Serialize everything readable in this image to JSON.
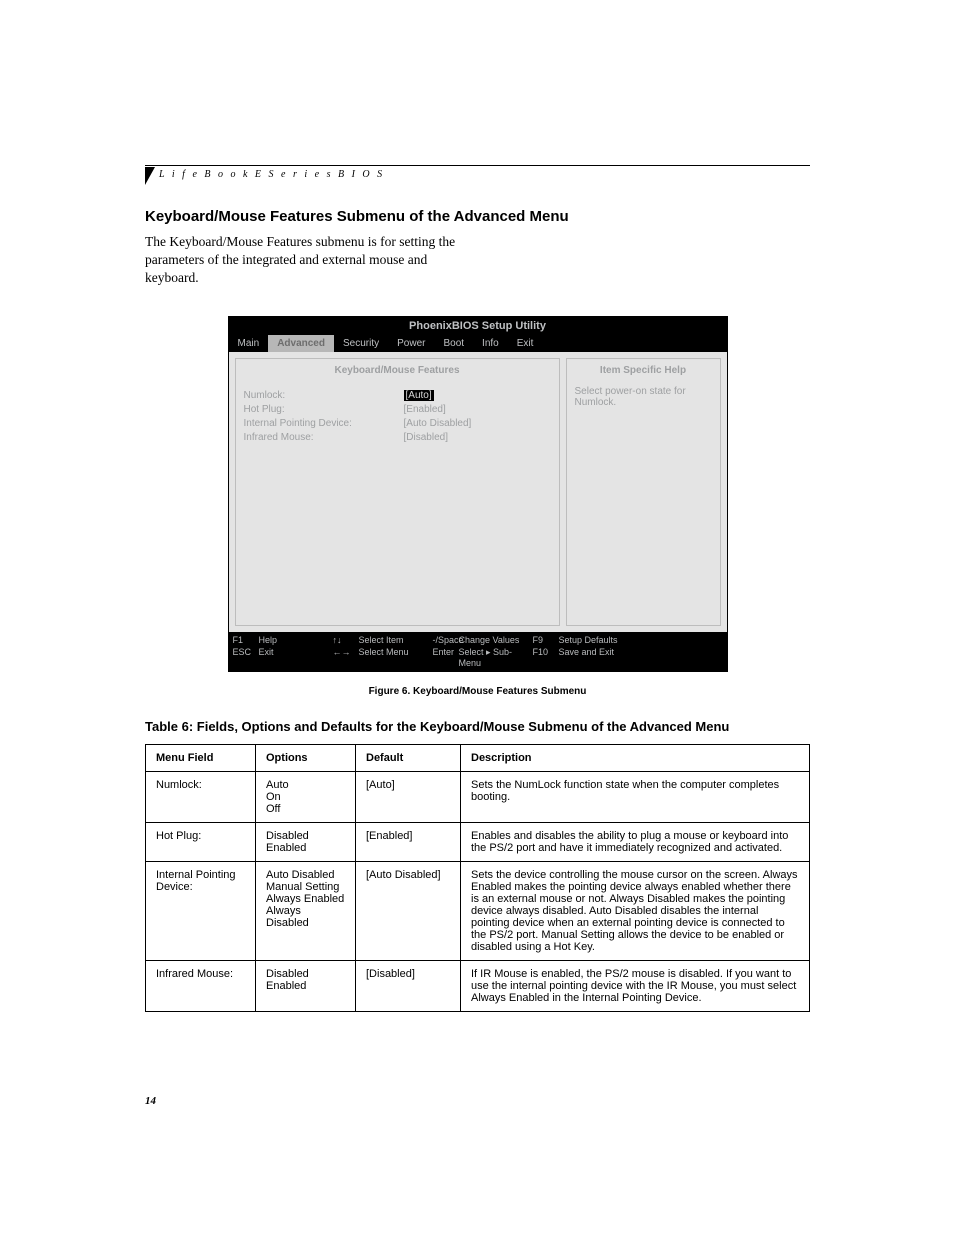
{
  "header": {
    "label": "L i f e B o o k   E   S e r i e s   B I O S"
  },
  "section_title": "Keyboard/Mouse Features Submenu of the Advanced Menu",
  "intro": "The Keyboard/Mouse Features submenu is for setting the parameters of the integrated and external mouse and keyboard.",
  "bios": {
    "title": "PhoenixBIOS Setup Utility",
    "tabs": [
      "Main",
      "Advanced",
      "Security",
      "Power",
      "Boot",
      "Info",
      "Exit"
    ],
    "active_tab": 1,
    "panel_title": "Keyboard/Mouse Features",
    "fields": [
      {
        "label": "Numlock:",
        "value": "[Auto]",
        "selected": true
      },
      {
        "label": "Hot Plug:",
        "value": "[Enabled]"
      },
      {
        "label": "Internal Pointing Device:",
        "value": "[Auto Disabled]"
      },
      {
        "label": "Infrared Mouse:",
        "value": "[Disabled]"
      }
    ],
    "help_title": "Item Specific Help",
    "help_text": "Select power-on state for Numlock.",
    "footer": [
      {
        "key": "F1",
        "label": "Help"
      },
      {
        "key": "↑↓",
        "label": "Select Item"
      },
      {
        "key": "-/Space",
        "label": "Change Values"
      },
      {
        "key": "F9",
        "label": "Setup Defaults"
      },
      {
        "key": "ESC",
        "label": "Exit"
      },
      {
        "key": "←→",
        "label": "Select Menu"
      },
      {
        "key": "Enter",
        "label": "Select ▸ Sub-Menu"
      },
      {
        "key": "F10",
        "label": "Save and Exit"
      }
    ]
  },
  "figure_caption": "Figure 6.  Keyboard/Mouse Features Submenu",
  "table_title": "Table 6: Fields, Options and Defaults for the Keyboard/Mouse Submenu of the Advanced Menu",
  "table": {
    "headers": [
      "Menu Field",
      "Options",
      "Default",
      "Description"
    ],
    "rows": [
      {
        "field": "Numlock:",
        "options": "Auto\nOn\nOff",
        "default": "[Auto]",
        "desc": "Sets the NumLock function state when the computer completes booting."
      },
      {
        "field": "Hot Plug:",
        "options": "Disabled\nEnabled",
        "default": "[Enabled]",
        "desc": "Enables and disables the ability to plug a mouse or keyboard into the PS/2 port and have it immediately recognized and activated."
      },
      {
        "field": "Internal Pointing Device:",
        "options": "Auto Disabled\nManual Setting\nAlways Enabled\nAlways Disabled",
        "default": "[Auto Disabled]",
        "desc": "Sets the device controlling the mouse cursor on the screen. Always Enabled makes the pointing device always enabled whether there is an external mouse or not. Always Disabled makes the pointing device always disabled. Auto Disabled disables the internal pointing device when an external pointing device is connected to the PS/2 port. Manual Setting allows the device to be enabled or disabled using a Hot Key."
      },
      {
        "field": "Infrared Mouse:",
        "options": "Disabled\nEnabled",
        "default": "[Disabled]",
        "desc": "If IR Mouse is enabled, the PS/2 mouse is disabled. If you want to use the internal pointing device with the IR Mouse, you must select Always Enabled in the Internal Pointing Device."
      }
    ]
  },
  "page_number": "14"
}
